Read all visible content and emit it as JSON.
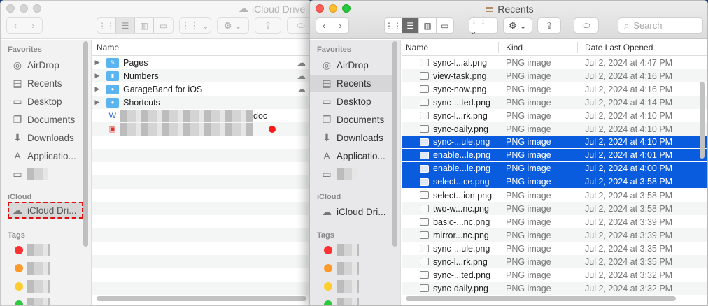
{
  "left_window": {
    "title": "iCloud Drive",
    "sidebar": {
      "favorites_label": "Favorites",
      "items": [
        "AirDrop",
        "Recents",
        "Desktop",
        "Documents",
        "Downloads",
        "Applicatio..."
      ],
      "icloud_label": "iCloud",
      "icloud_item": "iCloud Dri...",
      "tags_label": "Tags"
    },
    "column": "Name",
    "rows": [
      {
        "name": "Pages",
        "cloud": true
      },
      {
        "name": "Numbers",
        "cloud": true
      },
      {
        "name": "GarageBand for iOS",
        "cloud": true
      },
      {
        "name": "Shortcuts",
        "cloud": false
      }
    ],
    "doc_suffix": "doc"
  },
  "right_window": {
    "title": "Recents",
    "search_placeholder": "Search",
    "sidebar": {
      "favorites_label": "Favorites",
      "items": [
        "AirDrop",
        "Recents",
        "Desktop",
        "Documents",
        "Downloads",
        "Applicatio..."
      ],
      "icloud_label": "iCloud",
      "icloud_item": "iCloud Dri...",
      "tags_label": "Tags"
    },
    "columns": [
      "Name",
      "Kind",
      "Date Last Opened"
    ],
    "rows": [
      {
        "name": "sync-l...al.png",
        "kind": "PNG image",
        "date": "Jul 2, 2024 at 4:47 PM"
      },
      {
        "name": "view-task.png",
        "kind": "PNG image",
        "date": "Jul 2, 2024 at 4:16 PM"
      },
      {
        "name": "sync-now.png",
        "kind": "PNG image",
        "date": "Jul 2, 2024 at 4:16 PM"
      },
      {
        "name": "sync-...ted.png",
        "kind": "PNG image",
        "date": "Jul 2, 2024 at 4:14 PM"
      },
      {
        "name": "sync-l...rk.png",
        "kind": "PNG image",
        "date": "Jul 2, 2024 at 4:10 PM"
      },
      {
        "name": "sync-daily.png",
        "kind": "PNG image",
        "date": "Jul 2, 2024 at 4:10 PM"
      },
      {
        "name": "sync-...ule.png",
        "kind": "PNG image",
        "date": "Jul 2, 2024 at 4:10 PM",
        "selected": true
      },
      {
        "name": "enable...le.png",
        "kind": "PNG image",
        "date": "Jul 2, 2024 at 4:01 PM",
        "selected": true
      },
      {
        "name": "enable...le.png",
        "kind": "PNG image",
        "date": "Jul 2, 2024 at 4:00 PM",
        "selected": true
      },
      {
        "name": "select...ce.png",
        "kind": "PNG image",
        "date": "Jul 2, 2024 at 3:58 PM",
        "selected": true
      },
      {
        "name": "select...ion.png",
        "kind": "PNG image",
        "date": "Jul 2, 2024 at 3:58 PM"
      },
      {
        "name": "two-w...nc.png",
        "kind": "PNG image",
        "date": "Jul 2, 2024 at 3:58 PM"
      },
      {
        "name": "basic-...nc.png",
        "kind": "PNG image",
        "date": "Jul 2, 2024 at 3:39 PM"
      },
      {
        "name": "mirror...nc.png",
        "kind": "PNG image",
        "date": "Jul 2, 2024 at 3:39 PM"
      },
      {
        "name": "sync-...ule.png",
        "kind": "PNG image",
        "date": "Jul 2, 2024 at 3:35 PM"
      },
      {
        "name": "sync-l...rk.png",
        "kind": "PNG image",
        "date": "Jul 2, 2024 at 3:35 PM"
      },
      {
        "name": "sync-...ted.png",
        "kind": "PNG image",
        "date": "Jul 2, 2024 at 3:32 PM"
      },
      {
        "name": "sync-daily.png",
        "kind": "PNG image",
        "date": "Jul 2, 2024 at 3:32 PM"
      }
    ]
  },
  "colors": {
    "selection": "#0a5cde",
    "highlight_outline": "#e01010",
    "tags": [
      "#ff3030",
      "#ff9a2a",
      "#ffce2e",
      "#2dc93e"
    ]
  }
}
